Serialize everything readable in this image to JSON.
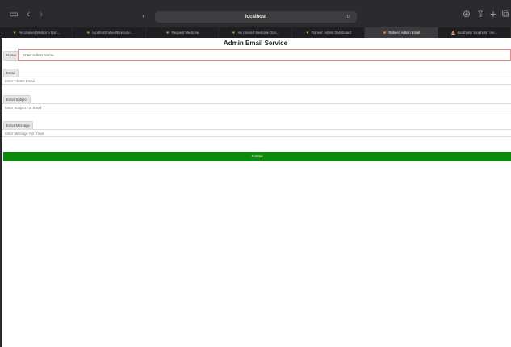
{
  "browser": {
    "address": "localhost",
    "toolbar_icons": {
      "sidebar": "sidebar-icon",
      "back": "chevron-left-icon",
      "forward": "chevron-right-icon",
      "shield": "shield-icon",
      "reload": "reload-icon",
      "download": "download-icon",
      "share": "share-icon",
      "new_tab": "plus-icon",
      "tabs_overview": "tabs-overview-icon"
    },
    "tabs": [
      {
        "label": "An Unused Medicine Don...",
        "icon": "leaf",
        "active": false
      },
      {
        "label": "localhost/raheel/Executiv...",
        "icon": "leaf",
        "active": false
      },
      {
        "label": "Request Medicine",
        "icon": "leaf",
        "active": false
      },
      {
        "label": "An Unused Medicine Don...",
        "icon": "leaf",
        "active": false
      },
      {
        "label": "Raheel: Admin Dashboard",
        "icon": "leaf",
        "active": false
      },
      {
        "label": "Raheel: Admin Email",
        "icon": "square",
        "active": true
      },
      {
        "label": "localhost / localhost / me...",
        "icon": "phpmyadmin",
        "active": false
      }
    ]
  },
  "page": {
    "title": "Admin Email Service",
    "name_label": "Name",
    "name_placeholder": "Enter Admin Name",
    "email_label": "Email",
    "email_placeholder": "Enter Clients Email",
    "subject_label": "Enter Subject",
    "subject_placeholder": "Enter Subject For Email",
    "message_label": "Enter Message",
    "message_placeholder": "Enter Message For Email",
    "submit_label": "Submit"
  },
  "colors": {
    "toolbar_bg": "#2b2b2d",
    "tabs_bg": "#1f1f21",
    "active_tab_bg": "#3b3b3e",
    "name_input_border": "#e58c8c",
    "submit_bg": "#0d8a0d"
  }
}
